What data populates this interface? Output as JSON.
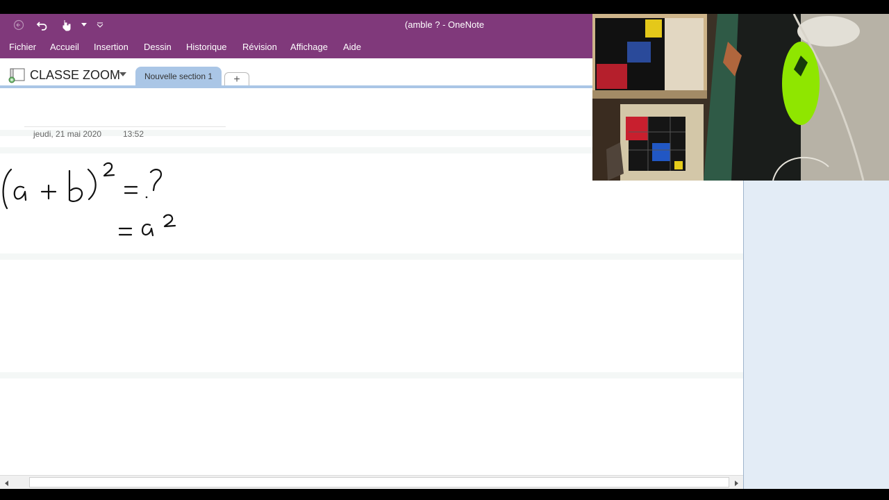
{
  "window": {
    "title": "(amble ?  -  OneNote"
  },
  "quick_access": {
    "icons": [
      "back-arrow-icon",
      "undo-icon",
      "touch-mode-icon",
      "dropdown-arrow-icon",
      "customize-toolbar-icon"
    ]
  },
  "menu": {
    "items": [
      {
        "label": "Fichier"
      },
      {
        "label": "Accueil"
      },
      {
        "label": "Insertion"
      },
      {
        "label": "Dessin"
      },
      {
        "label": "Historique"
      },
      {
        "label": "Révision"
      },
      {
        "label": "Affichage"
      },
      {
        "label": "Aide"
      }
    ]
  },
  "notebook": {
    "name": "CLASSE ZOOM",
    "section_tab": "Nouvelle section 1",
    "add_tab_label": "+"
  },
  "page": {
    "date": "jeudi, 21 mai 2020",
    "time": "13:52",
    "ink_text": [
      "(a + b)² = ?",
      "= a²"
    ]
  },
  "colors": {
    "ribbon": "#80397b",
    "section_tab": "#aac6e6",
    "right_pane": "#e3ecf6",
    "ink": "#111111"
  },
  "webcam": {
    "description_icons": [
      "webcam-feed"
    ]
  }
}
